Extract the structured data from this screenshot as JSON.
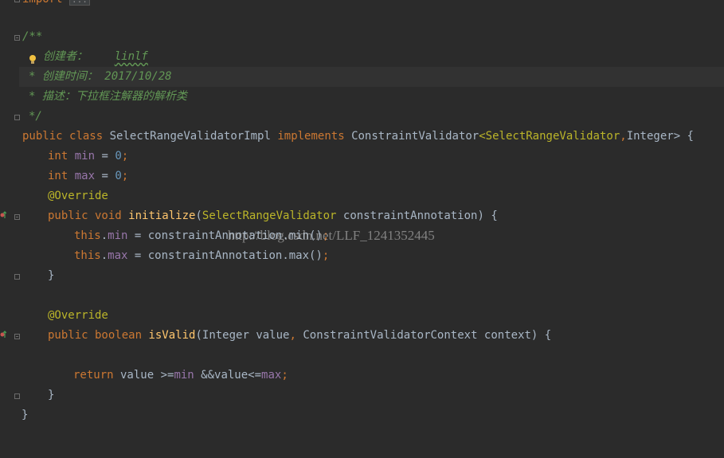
{
  "editor": {
    "line_import": {
      "keyword": "import",
      "folded": "..."
    },
    "doc_comment": {
      "open": "/**",
      "author_label": "创建者：",
      "author_value": "linlf",
      "date_line": "* 创建时间： 2017/10/28",
      "desc_line": "* 描述：下拉框注解器的解析类",
      "close": "*/"
    },
    "class_decl": {
      "public": "public",
      "class": "class",
      "name": "SelectRangeValidatorImpl",
      "implements": "implements",
      "iface": "ConstraintValidator",
      "lt": "<",
      "type1": "SelectRangeValidator",
      "comma": ",",
      "type2": "Integer",
      "gt_brace": "> {"
    },
    "field_min": {
      "type": "int",
      "name": "min",
      "eq": " = ",
      "value": "0",
      "semi": ";"
    },
    "field_max": {
      "type": "int",
      "name": "max",
      "eq": " = ",
      "value": "0",
      "semi": ";"
    },
    "override1": "@Override",
    "init_decl": {
      "mods": "public void",
      "name": "initialize",
      "paren_open": "(",
      "ptype": "SelectRangeValidator",
      "pname": " constraintAnnotation) {"
    },
    "init_body1": {
      "this": "this",
      "dot": ".",
      "field": "min",
      "rest": " = constraintAnnotation.min()",
      "semi": ";"
    },
    "init_body2": {
      "this": "this",
      "dot": ".",
      "field": "max",
      "rest": " = constraintAnnotation.max()",
      "semi": ";"
    },
    "close_brace": "}",
    "override2": "@Override",
    "isvalid_decl": {
      "mods": "public boolean",
      "name": "isValid",
      "params_a": "(Integer value",
      "comma": ",",
      "params_b": " ConstraintValidatorContext context) {"
    },
    "return_stmt": {
      "kw": "return",
      "a": " value >=",
      "f1": "min",
      "b": " &&value<=",
      "f2": "max",
      "semi": ";"
    },
    "close_brace_inner": "}",
    "close_brace_class": "}"
  },
  "watermark": "http://blog.csdn.net/LLF_1241352445",
  "colors": {
    "background": "#2b2b2b",
    "keyword": "#cc7832",
    "function": "#ffc66d",
    "field": "#9876aa",
    "number": "#6897bb",
    "annotation": "#bbb529",
    "comment": "#629755"
  }
}
